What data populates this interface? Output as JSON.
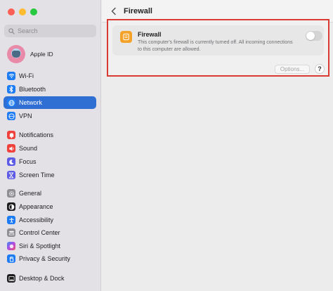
{
  "window": {
    "controls": [
      "close",
      "minimize",
      "zoom"
    ]
  },
  "sidebar": {
    "search": {
      "placeholder": "Search",
      "value": ""
    },
    "apple_id": {
      "label": "Apple ID"
    },
    "items": [
      {
        "label": "Wi-Fi",
        "icon": "wifi-icon",
        "color": "#1d7bf5",
        "selected": false
      },
      {
        "label": "Bluetooth",
        "icon": "bluetooth-icon",
        "color": "#1d7bf5",
        "selected": false
      },
      {
        "label": "Network",
        "icon": "globe-icon",
        "color": "#1d7bf5",
        "selected": true
      },
      {
        "label": "VPN",
        "icon": "vpn-icon",
        "color": "#1d7bf5",
        "selected": false
      },
      {
        "label": "Notifications",
        "icon": "bell-icon",
        "color": "#f0413d",
        "selected": false
      },
      {
        "label": "Sound",
        "icon": "speaker-icon",
        "color": "#f0413d",
        "selected": false
      },
      {
        "label": "Focus",
        "icon": "moon-icon",
        "color": "#5e5ce6",
        "selected": false
      },
      {
        "label": "Screen Time",
        "icon": "hourglass-icon",
        "color": "#5e5ce6",
        "selected": false
      },
      {
        "label": "General",
        "icon": "gear-icon",
        "color": "#8e8e93",
        "selected": false
      },
      {
        "label": "Appearance",
        "icon": "appearance-icon",
        "color": "#1c1c1e",
        "selected": false
      },
      {
        "label": "Accessibility",
        "icon": "accessibility-icon",
        "color": "#1d7bf5",
        "selected": false
      },
      {
        "label": "Control Center",
        "icon": "control-center-icon",
        "color": "#8e8e93",
        "selected": false
      },
      {
        "label": "Siri & Spotlight",
        "icon": "siri-icon",
        "color": "#b44be1",
        "selected": false
      },
      {
        "label": "Privacy & Security",
        "icon": "hand-icon",
        "color": "#1d7bf5",
        "selected": false
      },
      {
        "label": "Desktop & Dock",
        "icon": "dock-icon",
        "color": "#1c1c1e",
        "selected": false
      }
    ]
  },
  "header": {
    "title": "Firewall",
    "back_icon": "chevron-left-icon"
  },
  "firewall": {
    "title": "Firewall",
    "description": "This computer's firewall is currently turned off. All incoming connections to this computer are allowed.",
    "enabled": false,
    "icon": "firewall-icon",
    "icon_color": "#f4a32a",
    "options_label": "Options...",
    "help_label": "?",
    "highlight_color": "#d93a31"
  }
}
